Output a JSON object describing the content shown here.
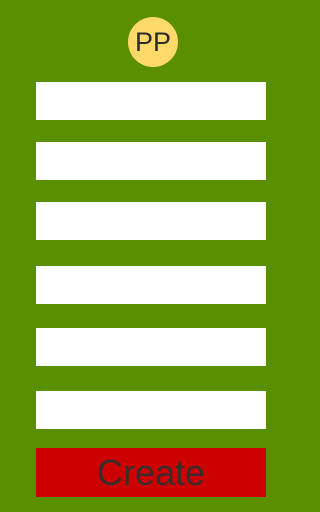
{
  "header": {
    "avatar_initials": "PP"
  },
  "form": {
    "fields": [
      {
        "value": "",
        "placeholder": ""
      },
      {
        "value": "",
        "placeholder": ""
      },
      {
        "value": "",
        "placeholder": ""
      },
      {
        "value": "",
        "placeholder": ""
      },
      {
        "value": "",
        "placeholder": ""
      },
      {
        "value": "",
        "placeholder": ""
      }
    ],
    "submit_label": "Create"
  },
  "colors": {
    "background": "#5a8f00",
    "avatar": "#ffda6b",
    "button": "#cc0000",
    "button_text": "#3a2d2d",
    "field": "#ffffff"
  }
}
